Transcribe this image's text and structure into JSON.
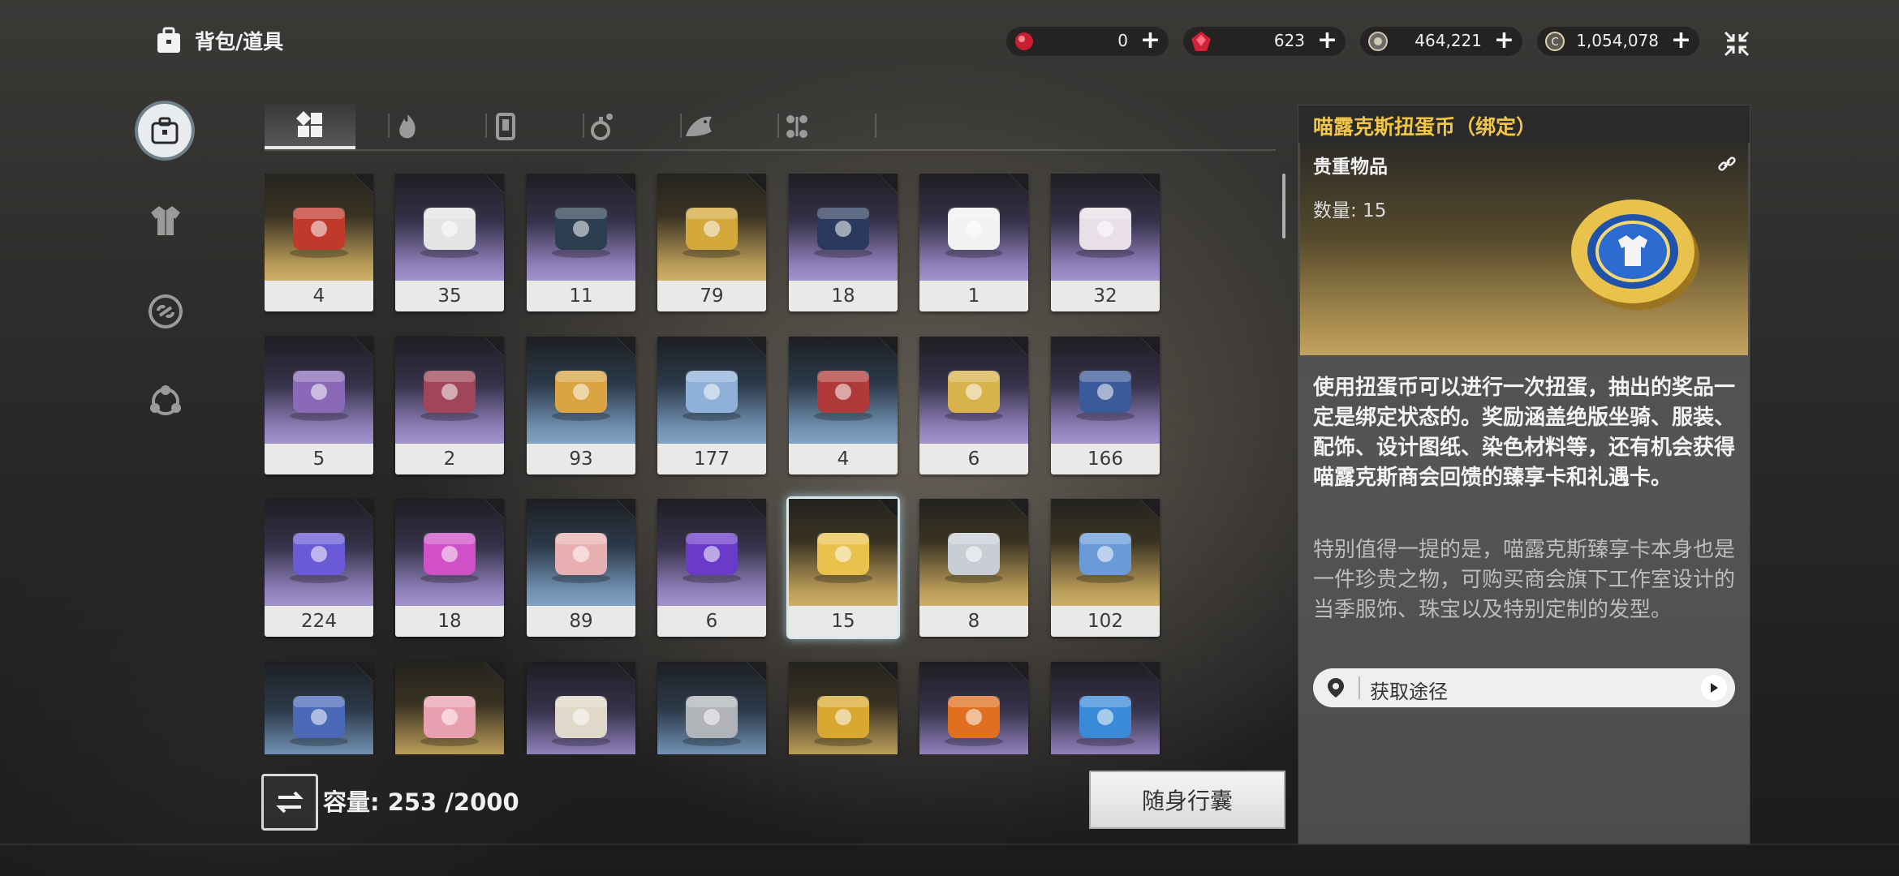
{
  "header": {
    "title": "背包/道具",
    "currencies": [
      {
        "icon": "red-gem-icon",
        "value": "0"
      },
      {
        "icon": "ruby-icon",
        "value": "623"
      },
      {
        "icon": "silver-coin-icon",
        "value": "464,221"
      },
      {
        "icon": "gold-coin-icon",
        "value": "1,054,078"
      }
    ]
  },
  "sidebar": {
    "items": [
      {
        "icon": "backpack-icon",
        "active": true
      },
      {
        "icon": "outfit-icon",
        "active": false
      },
      {
        "icon": "accessory-icon",
        "active": false
      },
      {
        "icon": "group-icon",
        "active": false
      }
    ]
  },
  "tabs": [
    {
      "icon": "all-items-icon",
      "active": true
    },
    {
      "icon": "material-icon",
      "active": false
    },
    {
      "icon": "card-icon",
      "active": false
    },
    {
      "icon": "potion-icon",
      "active": false
    },
    {
      "icon": "fish-icon",
      "active": false
    },
    {
      "icon": "misc-icon",
      "active": false
    }
  ],
  "items": [
    {
      "count": "4",
      "rarity": "gold",
      "icon": "red-gift-box-icon"
    },
    {
      "count": "35",
      "rarity": "purple",
      "icon": "treasure-chest-icon"
    },
    {
      "count": "11",
      "rarity": "purple",
      "icon": "dark-gift-box-icon"
    },
    {
      "count": "79",
      "rarity": "gold",
      "icon": "gold-gift-box-icon"
    },
    {
      "count": "18",
      "rarity": "purple",
      "icon": "navy-chest-icon"
    },
    {
      "count": "1",
      "rarity": "purple",
      "icon": "white-chest-icon"
    },
    {
      "count": "32",
      "rarity": "purple",
      "icon": "pouch-icon"
    },
    {
      "count": "5",
      "rarity": "purple",
      "icon": "pouch-icon"
    },
    {
      "count": "2",
      "rarity": "purple",
      "icon": "bottle-chest-icon"
    },
    {
      "count": "93",
      "rarity": "blue",
      "icon": "gold-box-icon"
    },
    {
      "count": "177",
      "rarity": "blue",
      "icon": "blue-gift-box-icon"
    },
    {
      "count": "4",
      "rarity": "blue",
      "icon": "red-key-icon"
    },
    {
      "count": "6",
      "rarity": "purple",
      "icon": "gold-key-icon"
    },
    {
      "count": "166",
      "rarity": "purple",
      "icon": "ticket-coin-icon"
    },
    {
      "count": "224",
      "rarity": "purple",
      "icon": "blue-crystal-icon"
    },
    {
      "count": "18",
      "rarity": "purple",
      "icon": "pink-crystal-icon"
    },
    {
      "count": "89",
      "rarity": "blue",
      "icon": "ticket-icon"
    },
    {
      "count": "6",
      "rarity": "purple",
      "icon": "purple-disc-icon"
    },
    {
      "count": "15",
      "rarity": "gold",
      "icon": "gacha-coin-icon",
      "selected": true
    },
    {
      "count": "8",
      "rarity": "gold",
      "icon": "silver-flame-coin-icon"
    },
    {
      "count": "102",
      "rarity": "gold",
      "icon": "fan-ornament-icon"
    },
    {
      "count": "",
      "rarity": "blue",
      "icon": "pickaxe-icon"
    },
    {
      "count": "",
      "rarity": "gold",
      "icon": "pink-crystal-shard-icon"
    },
    {
      "count": "",
      "rarity": "purple",
      "icon": "scroll-icon"
    },
    {
      "count": "",
      "rarity": "blue",
      "icon": "silver-trophy-icon"
    },
    {
      "count": "",
      "rarity": "gold",
      "icon": "gold-trophy-icon"
    },
    {
      "count": "",
      "rarity": "purple",
      "icon": "orange-pass-icon"
    },
    {
      "count": "",
      "rarity": "purple",
      "icon": "potion-flask-icon"
    }
  ],
  "capacity": {
    "label": "容量: 253 /2000"
  },
  "carry_button": "随身行囊",
  "detail": {
    "title": "喵露克斯扭蛋币（绑定）",
    "category": "贵重物品",
    "quantity": "数量: 15",
    "desc1": "使用扭蛋币可以进行一次扭蛋，抽出的奖品一定是绑定状态的。奖励涵盖绝版坐骑、服装、配饰、设计图纸、染色材料等，还有机会获得喵露克斯商会回馈的臻享卡和礼遇卡。",
    "desc2": "特别值得一提的是，喵露克斯臻享卡本身也是一件珍贵之物，可购买商会旗下工作室设计的当季服饰、珠宝以及特别定制的发型。",
    "source_label": "获取途径"
  },
  "colors": {
    "accent_title": "#f0c54a",
    "rarity_gold": "#cdb06a",
    "rarity_purple": "#a393cc",
    "rarity_blue": "#85a3c2"
  }
}
